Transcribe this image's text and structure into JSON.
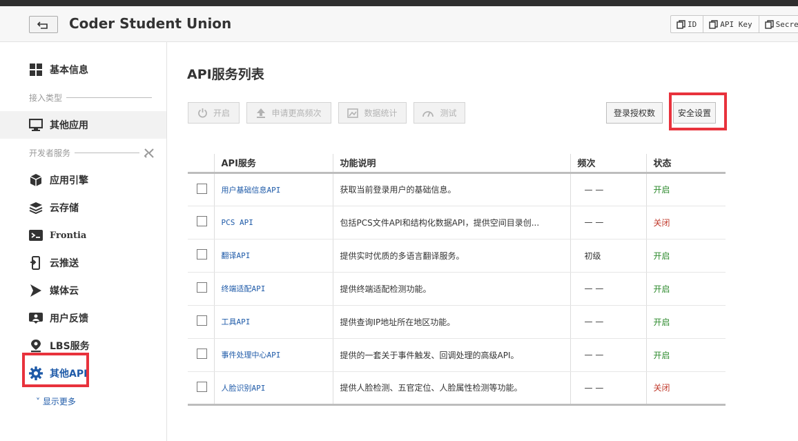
{
  "header": {
    "app_title": "Coder Student Union",
    "credentials": [
      {
        "label": "ID",
        "icon": "copy-icon"
      },
      {
        "label": "API Key",
        "icon": "copy-icon"
      },
      {
        "label": "Secre",
        "icon": "copy-icon"
      }
    ]
  },
  "sidebar": {
    "basic_info": "基本信息",
    "section_access": "接入类型",
    "other_apps": "其他应用",
    "section_dev": "开发者服务",
    "app_engine": "应用引擎",
    "cloud_storage": "云存储",
    "frontia": "Frontia",
    "cloud_push": "云推送",
    "media_cloud": "媒体云",
    "feedback": "用户反馈",
    "lbs": "LBS服务",
    "other_api": "其他API",
    "show_more": "显示更多"
  },
  "main": {
    "title": "API服务列表",
    "toolbar": {
      "enable": "开启",
      "request_freq": "申请更高频次",
      "stats": "数据统计",
      "test": "测试",
      "login_auth": "登录授权数",
      "security": "安全设置"
    },
    "table": {
      "headers": [
        "",
        "API服务",
        "功能说明",
        "频次",
        "状态"
      ],
      "rows": [
        {
          "name": "用户基础信息API",
          "desc": "获取当前登录用户的基础信息。",
          "freq": "— —",
          "status": "开启",
          "on": true
        },
        {
          "name": "PCS API",
          "desc": "包括PCS文件API和结构化数据API，提供空间目录创...",
          "freq": "— —",
          "status": "关闭",
          "on": false
        },
        {
          "name": "翻译API",
          "desc": "提供实时优质的多语言翻译服务。",
          "freq": "初级",
          "status": "开启",
          "on": true
        },
        {
          "name": "终端适配API",
          "desc": "提供终端适配检测功能。",
          "freq": "— —",
          "status": "开启",
          "on": true
        },
        {
          "name": "工具API",
          "desc": "提供查询IP地址所在地区功能。",
          "freq": "— —",
          "status": "开启",
          "on": true
        },
        {
          "name": "事件处理中心API",
          "desc": "提供的一套关于事件触发、回调处理的高级API。",
          "freq": "— —",
          "status": "开启",
          "on": true
        },
        {
          "name": "人脸识别API",
          "desc": "提供人脸检测、五官定位、人脸属性检测等功能。",
          "freq": "— —",
          "status": "关闭",
          "on": false
        }
      ]
    }
  },
  "colors": {
    "highlight_box": "#e8323c",
    "link": "#1e5aa8",
    "status_on": "#2e8b2e",
    "status_off": "#c0392b"
  }
}
